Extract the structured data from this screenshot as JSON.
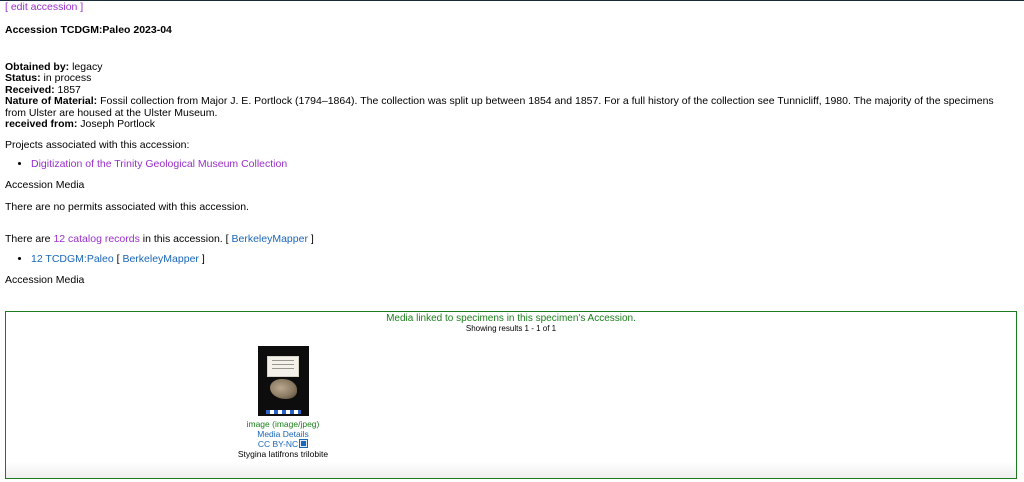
{
  "edit_link": "[ edit accession ]",
  "title": "Accession TCDGM:Paleo 2023-04",
  "details": {
    "obtained_by_label": "Obtained by:",
    "obtained_by": "legacy",
    "status_label": "Status:",
    "status": "in process",
    "received_label": "Received:",
    "received": "1857",
    "nature_label": "Nature of Material:",
    "nature": "Fossil collection from Major J. E. Portlock (1794–1864). The collection was split up between 1854 and 1857. For a full history of the collection see Tunnicliff, 1980. The majority of the specimens from Ulster are housed at the Ulster Museum.",
    "received_from_label": "received from:",
    "received_from": "Joseph Portlock"
  },
  "projects": {
    "label": "Projects associated with this accession:",
    "items": [
      "Digitization of the Trinity Geological Museum Collection"
    ]
  },
  "media_heading_1": "Accession Media",
  "permits_text": "There are no permits associated with this accession.",
  "catalog": {
    "prefix": "There are ",
    "link": "12 catalog records",
    "suffix": " in this accession.",
    "mapper_open": " [ ",
    "mapper": "BerkeleyMapper",
    "mapper_close": " ]",
    "items": [
      {
        "link": "12 TCDGM:Paleo",
        "mapper_open": " [ ",
        "mapper": "BerkeleyMapper",
        "mapper_close": " ]"
      }
    ]
  },
  "media_heading_2": "Accession Media",
  "media_box": {
    "heading": "Media linked to specimens in this specimen's Accession.",
    "results": "Showing results 1 - 1 of 1",
    "item": {
      "type_link": "image (image/jpeg)",
      "details_link": "Media Details",
      "license_link": "CC BY-NC",
      "license_icon": "external-link-icon",
      "caption": "Stygina latifrons trilobite"
    }
  },
  "colors": {
    "visited_link": "#9b2fc9",
    "link": "#1a66b8",
    "box_border": "#1e7a1e",
    "box_heading": "#1a7f1a"
  }
}
